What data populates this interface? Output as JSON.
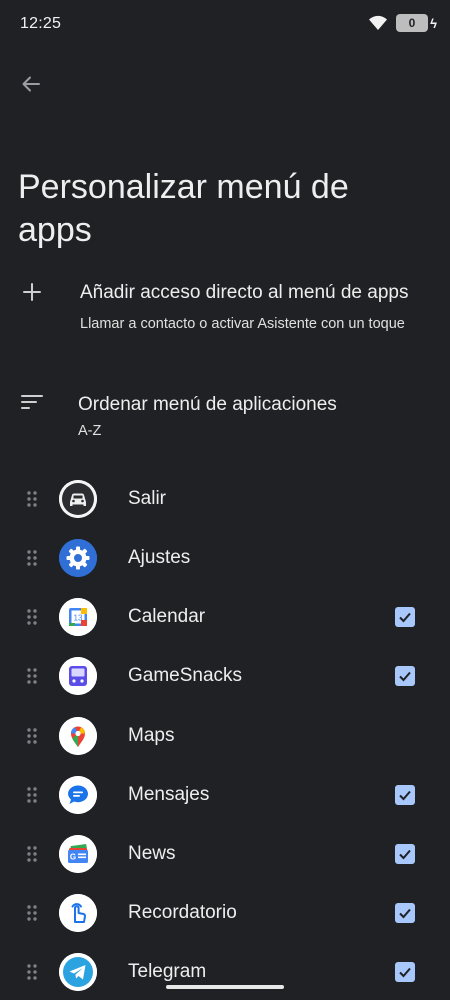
{
  "status": {
    "time": "12:25",
    "battery": "0"
  },
  "page": {
    "title": "Personalizar menú de apps"
  },
  "shortcut": {
    "title": "Añadir acceso directo al menú de apps",
    "subtitle": "Llamar a contacto o activar Asistente con un toque"
  },
  "sort": {
    "title": "Ordenar menú de aplicaciones",
    "value": "A-Z"
  },
  "apps": [
    {
      "label": "Salir",
      "icon": "car-icon",
      "checked": false
    },
    {
      "label": "Ajustes",
      "icon": "settings-gear-icon",
      "checked": false
    },
    {
      "label": "Calendar",
      "icon": "calendar-icon",
      "checked": true
    },
    {
      "label": "GameSnacks",
      "icon": "gamesnacks-icon",
      "checked": true
    },
    {
      "label": "Maps",
      "icon": "maps-pin-icon",
      "checked": false
    },
    {
      "label": "Mensajes",
      "icon": "messages-icon",
      "checked": true
    },
    {
      "label": "News",
      "icon": "news-icon",
      "checked": true
    },
    {
      "label": "Recordatorio",
      "icon": "reminder-hand-icon",
      "checked": true
    },
    {
      "label": "Telegram",
      "icon": "telegram-icon",
      "checked": true
    }
  ],
  "calendar_day": "13",
  "colors": {
    "background": "#1f2125",
    "checkbox": "#a8c7fa",
    "text": "#eeeeee"
  }
}
